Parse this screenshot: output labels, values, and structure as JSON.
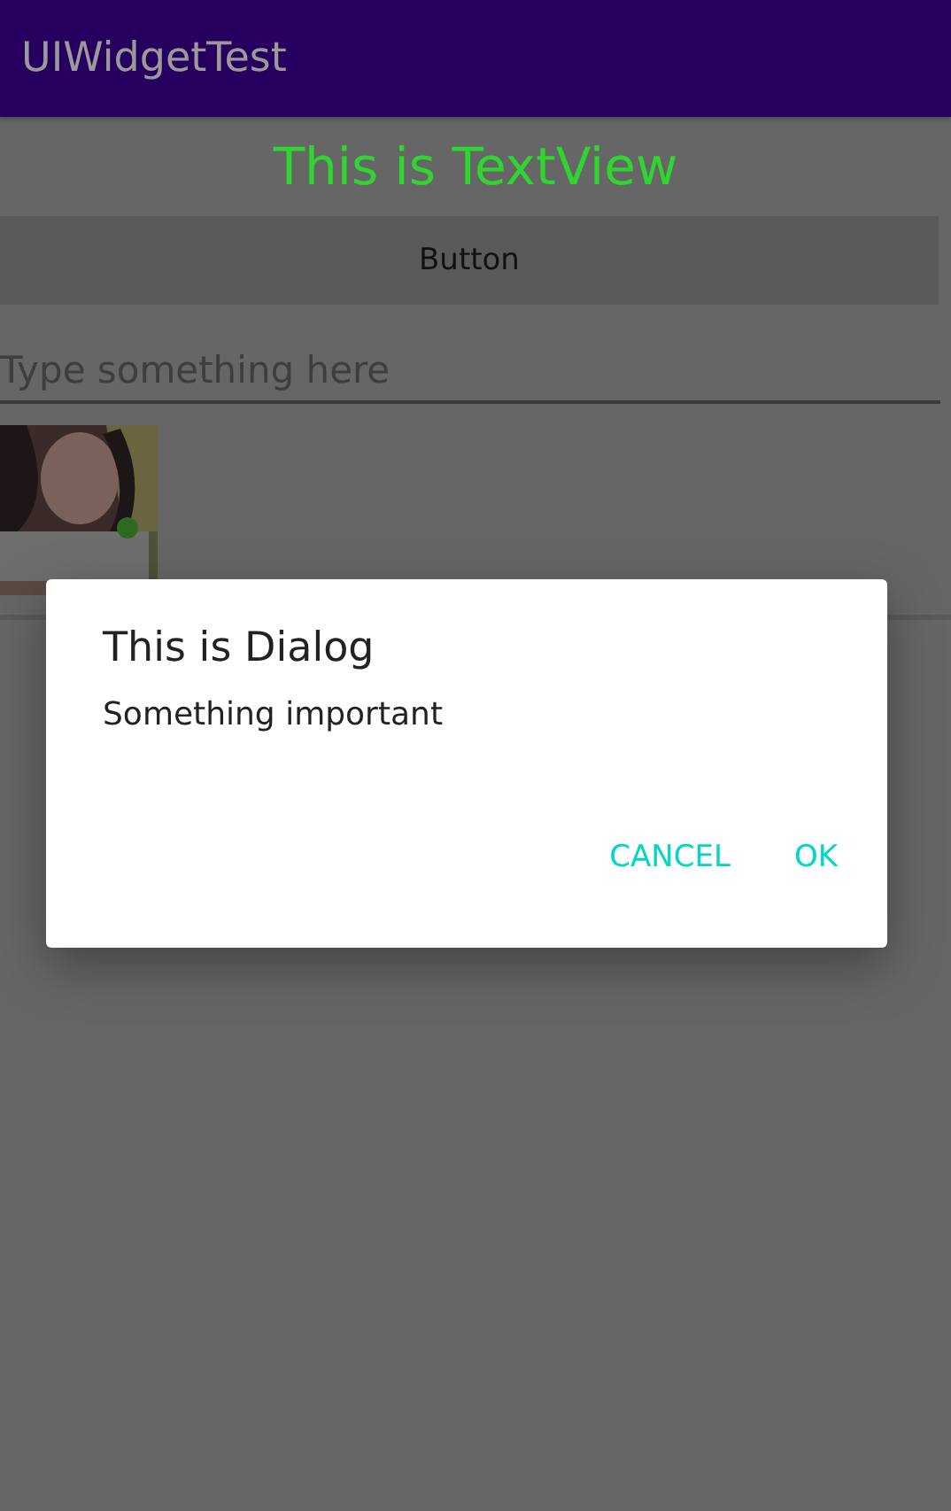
{
  "app_bar": {
    "title": "UIWidgetTest"
  },
  "text_view": {
    "text": "This is TextView"
  },
  "button": {
    "label": "Button"
  },
  "edit_text": {
    "placeholder": "Type something here"
  },
  "dialog": {
    "title": "This is Dialog",
    "message": "Something important",
    "buttons": [
      "CANCEL",
      "OK"
    ]
  }
}
